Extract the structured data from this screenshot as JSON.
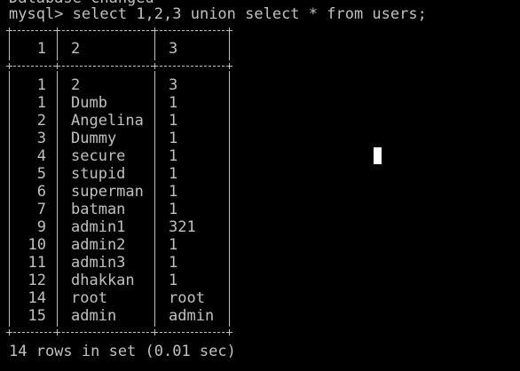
{
  "previous_output": "Database changed",
  "prompt": {
    "prefix": "mysql>",
    "command": "select 1,2,3 union select * from users;"
  },
  "table": {
    "columns": [
      "1",
      "2",
      "3"
    ],
    "rows": [
      [
        "1",
        "2",
        "3"
      ],
      [
        "1",
        "Dumb",
        "1"
      ],
      [
        "2",
        "Angelina",
        "1"
      ],
      [
        "3",
        "Dummy",
        "1"
      ],
      [
        "4",
        "secure",
        "1"
      ],
      [
        "5",
        "stupid",
        "1"
      ],
      [
        "6",
        "superman",
        "1"
      ],
      [
        "7",
        "batman",
        "1"
      ],
      [
        "9",
        "admin1",
        "321"
      ],
      [
        "10",
        "admin2",
        "1"
      ],
      [
        "11",
        "admin3",
        "1"
      ],
      [
        "12",
        "dhakkan",
        "1"
      ],
      [
        "14",
        "root",
        "root"
      ],
      [
        "15",
        "admin",
        "admin"
      ]
    ]
  },
  "summary": "14 rows in set (0.01 sec)",
  "colors": {
    "background": "#000000",
    "text": "#c0c0c0",
    "cursor": "#ffffff"
  }
}
